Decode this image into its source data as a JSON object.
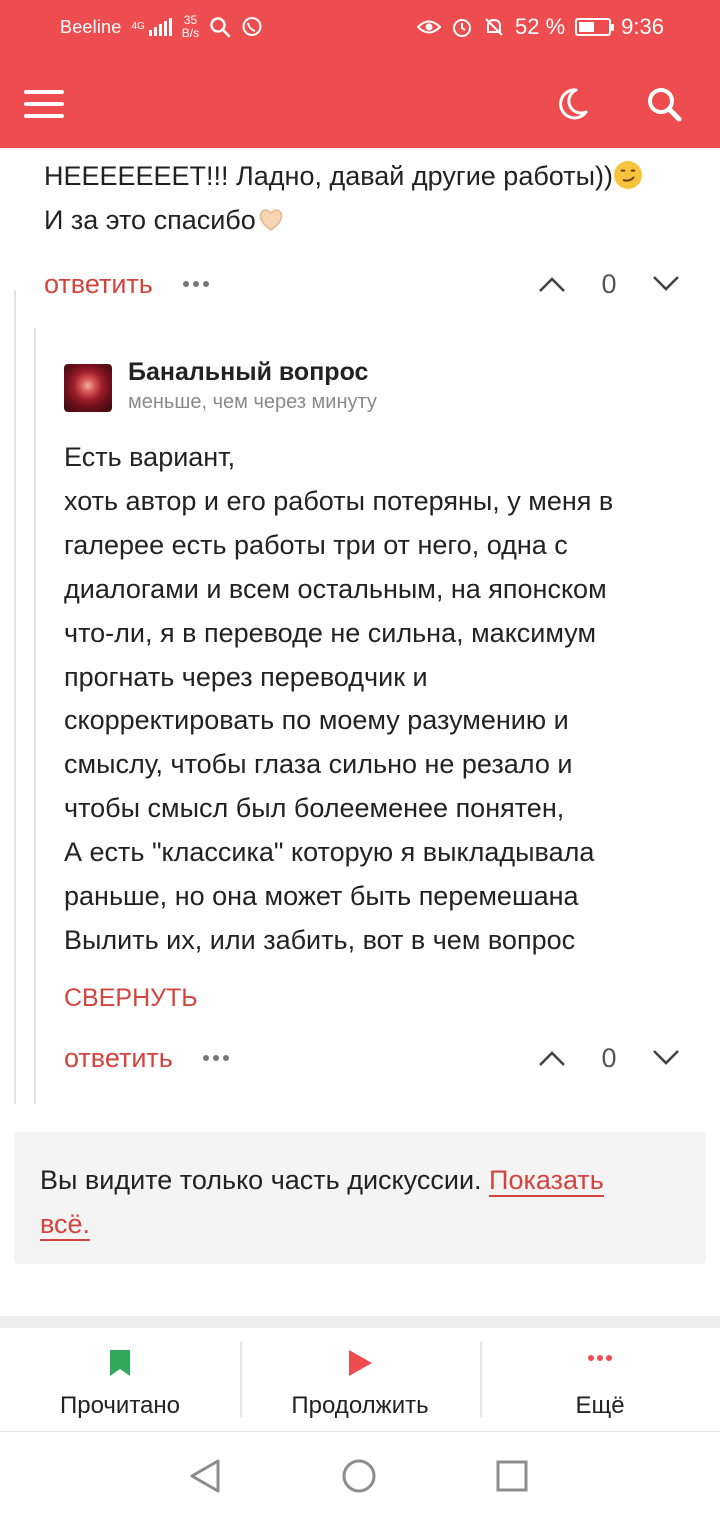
{
  "status_bar": {
    "carrier": "Beeline",
    "network": "4G",
    "speed_value": "35",
    "speed_unit": "B/s",
    "battery_percent": "52 %",
    "battery_level": 0.52,
    "time": "9:36"
  },
  "app_bar": {
    "icons": [
      "menu-icon",
      "moon-icon",
      "search-icon"
    ]
  },
  "previous_comment": {
    "text_lines": [
      "НЕЕЕЕЕЕЕТ!!! Ладно, давай другие работы))",
      "И за это спасибо"
    ],
    "emojis": [
      "smirking-face-emoji",
      "heart-hands-emoji"
    ],
    "reply_label": "ответить",
    "votes": "0"
  },
  "reply_comment": {
    "author": "Банальный вопрос",
    "time_ago": "меньше, чем через минуту",
    "body_lines": [
      "Есть вариант,",
      "хоть автор и его работы потеряны, у меня в",
      "галерее есть работы три от него, одна с",
      "диалогами и всем остальным, на японском",
      "что-ли, я в переводе не сильна, максимум",
      "прогнать через переводчик и",
      "скорректировать по моему разумению и",
      "смыслу, чтобы глаза сильно не резало и",
      "чтобы смысл был болееменее понятен,",
      "А есть \"классика\" которую я выкладывала",
      "раньше, но она может быть перемешана",
      "Вылить их, или забить, вот в чем вопрос"
    ],
    "collapse_label": "СВЕРНУТЬ",
    "reply_label": "ответить",
    "votes": "0"
  },
  "notice": {
    "text": "Вы видите только часть дискуссии. ",
    "link_part1": "Показать",
    "link_part2": "всё."
  },
  "bottom_nav": {
    "items": [
      {
        "label": "Прочитано",
        "icon": "bookmark-icon"
      },
      {
        "label": "Продолжить",
        "icon": "play-icon"
      },
      {
        "label": "Ещё",
        "icon": "more-dots-icon"
      }
    ]
  },
  "system_nav": {
    "icons": [
      "back-icon",
      "home-icon",
      "recents-icon"
    ]
  },
  "colors": {
    "accent": "#ee4d4f",
    "link": "#d4443e",
    "notice_bg": "#f4f4f4"
  }
}
